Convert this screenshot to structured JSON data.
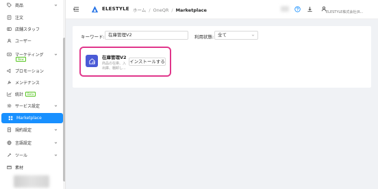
{
  "sidebar": {
    "items": [
      {
        "label": "商品",
        "icon": "tag-icon",
        "chevron": true
      },
      {
        "label": "注文",
        "icon": "order-icon"
      },
      {
        "label": "店舗スタッフ",
        "icon": "staff-icon"
      },
      {
        "label": "ユーザー",
        "icon": "user-icon"
      },
      {
        "label": "マーケティング",
        "icon": "marketing-icon",
        "chevron": true,
        "badge": "New"
      },
      {
        "label": "プロモーション",
        "icon": "promotion-icon"
      },
      {
        "label": "メンテナンス",
        "icon": "maintenance-icon"
      },
      {
        "label": "統計",
        "icon": "stats-icon",
        "badge": "Beta"
      },
      {
        "label": "サービス設定",
        "icon": "gear-icon",
        "chevron": true
      },
      {
        "label": "Marketplace",
        "icon": "marketplace-icon",
        "active": true
      },
      {
        "label": "規約設定",
        "icon": "terms-icon",
        "chevron": true
      },
      {
        "label": "言語設定",
        "icon": "language-icon",
        "chevron": true
      },
      {
        "label": "ツール",
        "icon": "tool-icon",
        "chevron": true
      },
      {
        "label": "素材",
        "icon": "material-icon"
      }
    ]
  },
  "header": {
    "brand": "ELESTYLE",
    "breadcrumb": [
      "ホーム",
      "OneQR",
      "Marketplace"
    ],
    "account": "ELESTYLE株式会社(R..."
  },
  "filters": {
    "keyword_label": "キーワード:",
    "keyword_value": "在庫管理V2",
    "status_label": "利用状態:",
    "status_value": "全て"
  },
  "apps": [
    {
      "name": "在庫管理V2",
      "desc_line1": "商品の在庫、入",
      "desc_line2": "出庫、棚卸し...",
      "install_label": "インストールする"
    }
  ],
  "colors": {
    "accent": "#1890ff",
    "highlight": "#e0348a",
    "app_icon": "#4a5ad6",
    "badge": "#52c41a"
  }
}
